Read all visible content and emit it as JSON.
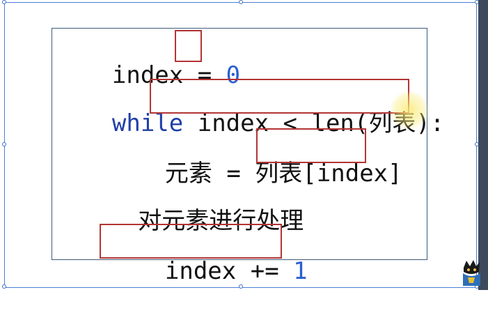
{
  "code": {
    "line1": {
      "var": "index",
      "op": " = ",
      "value": "0"
    },
    "line2": {
      "keyword": "while",
      "condition": "index < len(列表)",
      "colon": ":"
    },
    "line3": {
      "lhs": "元素 = 列表",
      "index_expr": "[index]"
    },
    "line4": {
      "text": "对元素进行处理"
    },
    "line5": {
      "var": "index",
      "op": " += ",
      "value": "1"
    }
  },
  "colors": {
    "keyword": "#1f3fa6",
    "number": "#2a5fd0",
    "highlight_box": "#b33434",
    "code_border": "#3a5a7a",
    "selection": "#4a7fd4"
  },
  "icons": [
    "selection-handle",
    "mascot-avatar"
  ]
}
